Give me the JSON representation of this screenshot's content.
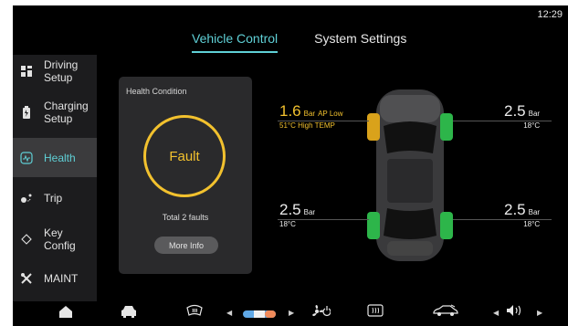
{
  "status": {
    "time": "12:29"
  },
  "tabs": [
    {
      "label": "Vehicle Control",
      "active": true
    },
    {
      "label": "System Settings",
      "active": false
    }
  ],
  "sidebar": {
    "items": [
      {
        "line1": "Driving",
        "line2": "Setup",
        "icon": "driving-setup-icon"
      },
      {
        "line1": "Charging",
        "line2": "Setup",
        "icon": "charging-icon"
      },
      {
        "line1": "Health",
        "line2": "",
        "icon": "health-icon",
        "active": true
      },
      {
        "line1": "Trip",
        "line2": "",
        "icon": "trip-icon"
      },
      {
        "line1": "Key",
        "line2": "Config",
        "icon": "key-icon"
      },
      {
        "line1": "MAINT",
        "line2": "",
        "icon": "wrench-icon"
      }
    ]
  },
  "health": {
    "title": "Health Condition",
    "status": "Fault",
    "faults": "Total 2 faults",
    "more_label": "More Info"
  },
  "tires": {
    "front_left": {
      "value": "1.6",
      "unit": "Bar",
      "alert": "AP Low",
      "temp": "51°C",
      "temp_alert": "High TEMP",
      "color": "#d9a21b"
    },
    "front_right": {
      "value": "2.5",
      "unit": "Bar",
      "temp": "18°C",
      "color": "#2db54a"
    },
    "rear_left": {
      "value": "2.5",
      "unit": "Bar",
      "temp": "18°C",
      "color": "#2db54a"
    },
    "rear_right": {
      "value": "2.5",
      "unit": "Bar",
      "temp": "18°C",
      "color": "#2db54a"
    }
  },
  "colors": {
    "accent": "#5fd0d6",
    "warning": "#f2c12e",
    "ok": "#2db54a"
  },
  "dock": {
    "items": [
      "home-icon",
      "car-icon",
      "defrost-front-icon",
      "fan-temp-slider",
      "fan-icon",
      "defrost-rear-icon",
      "car-side-icon",
      "volume-icon"
    ]
  }
}
